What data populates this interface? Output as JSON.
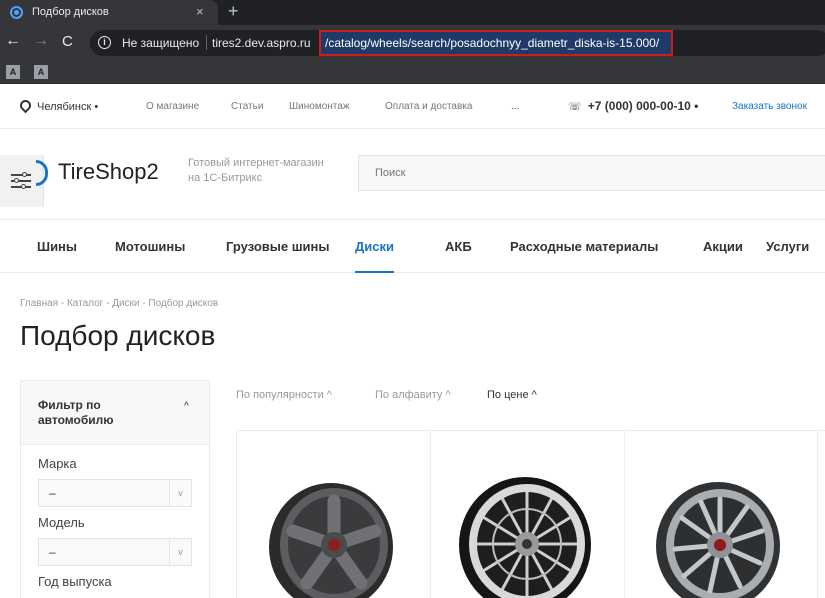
{
  "browser": {
    "tab_title": "Подбор дисков",
    "tab_close": "×",
    "new_tab": "+",
    "back": "←",
    "forward": "→",
    "reload": "C",
    "info": "i",
    "security_label": "Не защищено",
    "url_host": "tires2.dev.aspro.ru",
    "url_path": "/catalog/wheels/search/posadochnyy_diametr_diska-is-15.000/",
    "bookmarks": [
      "A",
      "A"
    ]
  },
  "topbar": {
    "city": "Челябинск",
    "nav": [
      "О магазине",
      "Статьи",
      "Шиномонтаж",
      "Оплата и доставка",
      "..."
    ],
    "phone": "+7 (000) 000-00-10",
    "callback": "Заказать звонок"
  },
  "header": {
    "logo": "TireShop2",
    "slogan": "Готовый интернет-магазин на 1С-Битрикс",
    "search_placeholder": "Поиск"
  },
  "menu": {
    "items": [
      "Шины",
      "Мотошины",
      "Грузовые шины",
      "Диски",
      "АКБ",
      "Расходные материалы",
      "Акции",
      "Услуги"
    ],
    "active": "Диски"
  },
  "page": {
    "breadcrumbs": "Главная - Каталог - Диски - Подбор дисков",
    "title": "Подбор дисков"
  },
  "filter": {
    "title": "Фильтр по автомобилю",
    "fields": [
      {
        "label": "Марка",
        "value": "–"
      },
      {
        "label": "Модель",
        "value": "–"
      },
      {
        "label": "Год выпуска",
        "value": ""
      }
    ]
  },
  "sort": {
    "options": [
      "По популярности ^",
      "По алфавиту ^",
      "По цене ^"
    ],
    "active": "По цене ^"
  },
  "products": [
    {
      "name": "wheel-dark-5-spoke"
    },
    {
      "name": "wheel-chrome-mesh"
    },
    {
      "name": "wheel-silver-multispoke"
    }
  ],
  "colors": {
    "accent": "#1a73c8",
    "url_highlight_border": "#d11a1a",
    "browser_dark": "#202124"
  }
}
